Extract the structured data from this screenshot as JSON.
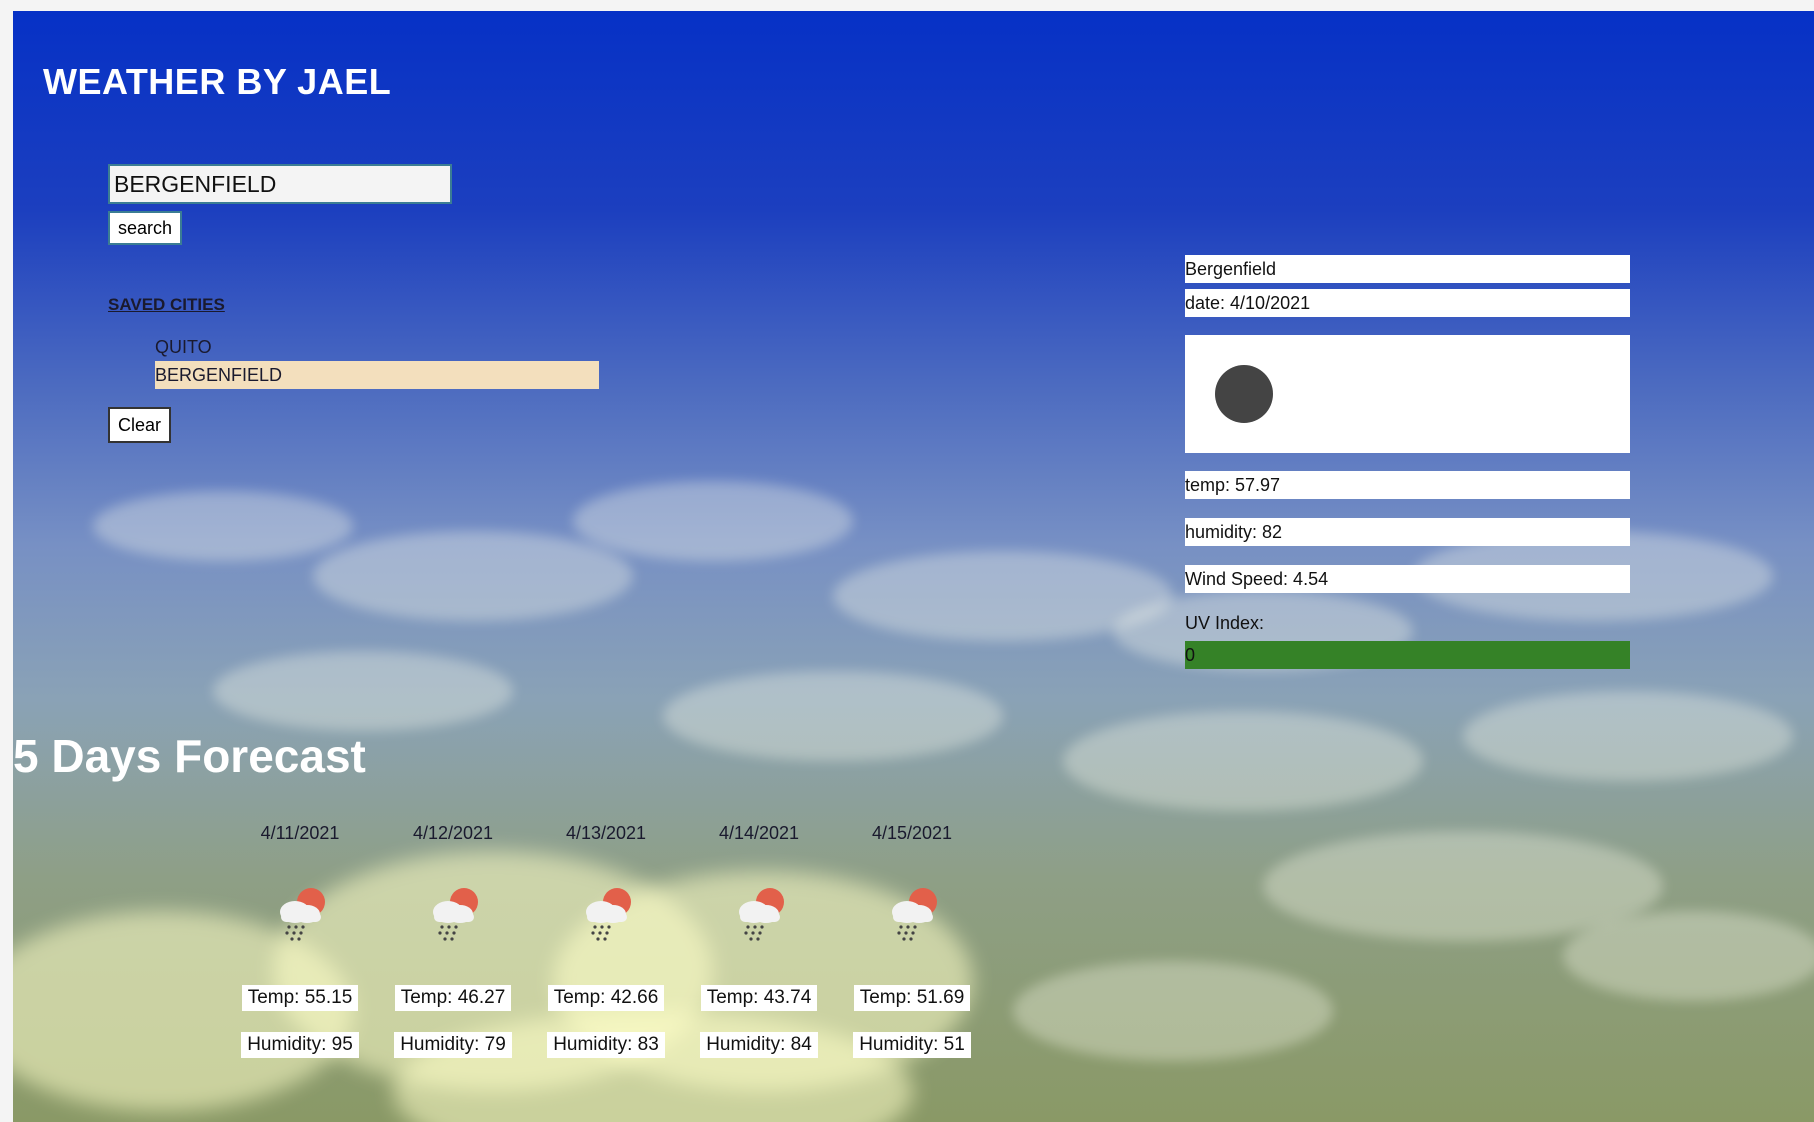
{
  "header": {
    "title": "WEATHER BY JAEL"
  },
  "search": {
    "value": "BERGENFIELD",
    "button_label": "search"
  },
  "saved": {
    "title": "SAVED CITIES",
    "items": [
      {
        "label": "QUITO"
      },
      {
        "label": "BERGENFIELD"
      }
    ],
    "clear_label": "Clear"
  },
  "current": {
    "city": "Bergenfield",
    "date": "date: 4/10/2021",
    "icon": "dark-circle-icon",
    "temp": "temp: 57.97",
    "humidity": "humidity: 82",
    "wind": "Wind Speed: 4.54",
    "uv_label": "UV Index:",
    "uv_value": "0",
    "uv_color": "#358227"
  },
  "forecast": {
    "title": "5 Days Forecast",
    "days": [
      {
        "date": "4/11/2021",
        "icon": "rain-sun-cloud-icon",
        "temp": "Temp: 55.15",
        "humidity": "Humidity: 95"
      },
      {
        "date": "4/12/2021",
        "icon": "rain-sun-cloud-icon",
        "temp": "Temp: 46.27",
        "humidity": "Humidity: 79"
      },
      {
        "date": "4/13/2021",
        "icon": "rain-sun-cloud-icon",
        "temp": "Temp: 42.66",
        "humidity": "Humidity: 83"
      },
      {
        "date": "4/14/2021",
        "icon": "rain-sun-cloud-icon",
        "temp": "Temp: 43.74",
        "humidity": "Humidity: 84"
      },
      {
        "date": "4/15/2021",
        "icon": "rain-sun-cloud-icon",
        "temp": "Temp: 51.69",
        "humidity": "Humidity: 51"
      }
    ]
  },
  "colors": {
    "sky_top": "#0631c6",
    "sky_bottom": "#8a9966",
    "active_city": "#f3dfbd",
    "input_border": "#3b7d94"
  }
}
